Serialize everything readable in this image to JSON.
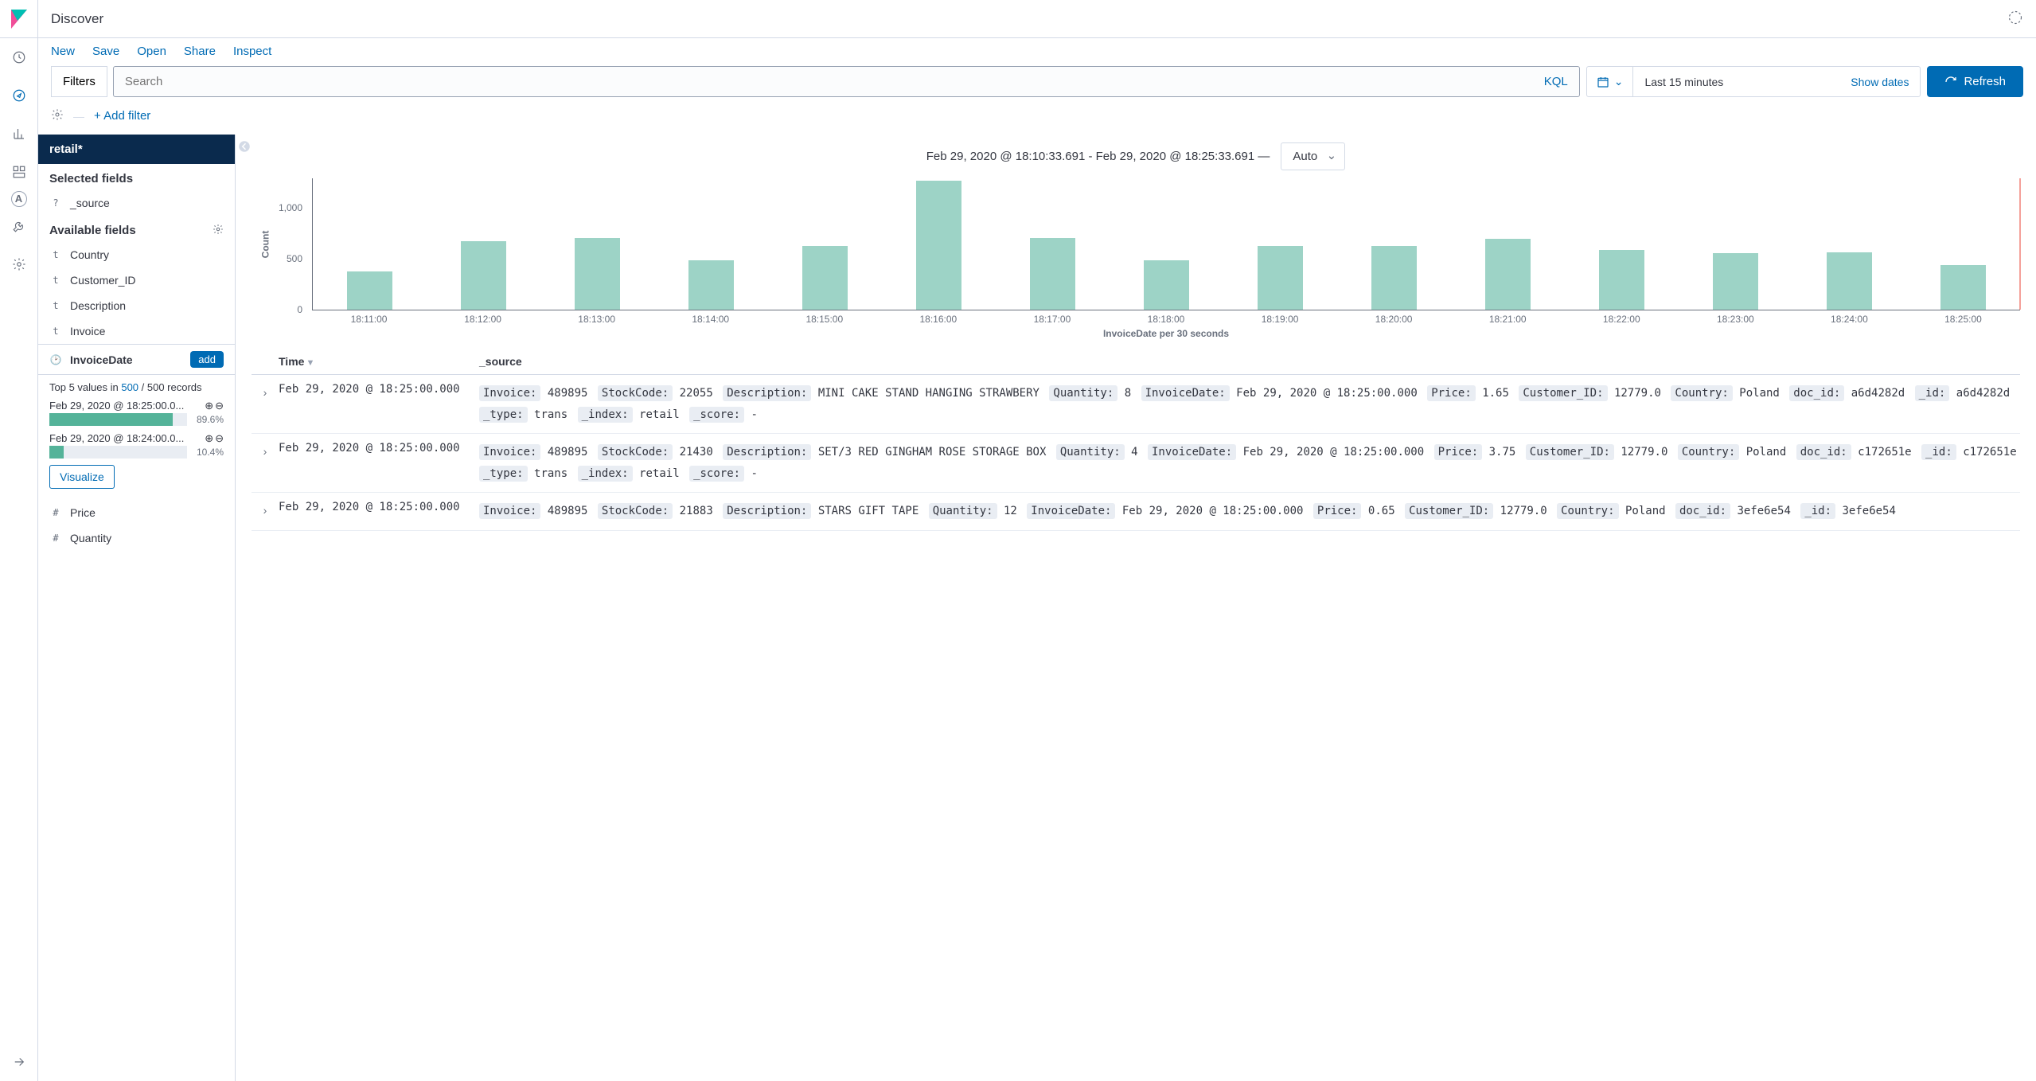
{
  "app": {
    "title": "Discover"
  },
  "subnav": {
    "new": "New",
    "save": "Save",
    "open": "Open",
    "share": "Share",
    "inspect": "Inspect"
  },
  "search": {
    "filters_btn": "Filters",
    "placeholder": "Search",
    "kql": "KQL"
  },
  "datepicker": {
    "range": "Last 15 minutes",
    "show_dates": "Show dates"
  },
  "refresh": {
    "label": "Refresh"
  },
  "filterbar": {
    "add_filter": "+ Add filter"
  },
  "sidebar": {
    "index_pattern": "retail*",
    "selected_title": "Selected fields",
    "selected": [
      {
        "icon": "?",
        "name": "_source"
      }
    ],
    "available_title": "Available fields",
    "available": [
      {
        "icon": "t",
        "name": "Country"
      },
      {
        "icon": "t",
        "name": "Customer_ID"
      },
      {
        "icon": "t",
        "name": "Description"
      },
      {
        "icon": "t",
        "name": "Invoice"
      }
    ],
    "selected_field": {
      "icon": "🕑",
      "name": "InvoiceDate",
      "add": "add"
    },
    "field_details": {
      "prefix": "Top 5 values in ",
      "link": "500",
      "suffix": " / 500 records",
      "rows": [
        {
          "label": "Feb 29, 2020 @ 18:25:00.0...",
          "pct": "89.6%",
          "width": 89.6
        },
        {
          "label": "Feb 29, 2020 @ 18:24:00.0...",
          "pct": "10.4%",
          "width": 10.4
        }
      ],
      "visualize": "Visualize"
    },
    "after": [
      {
        "icon": "#",
        "name": "Price"
      },
      {
        "icon": "#",
        "name": "Quantity"
      }
    ]
  },
  "histogram": {
    "range_text": "Feb 29, 2020 @ 18:10:33.691 - Feb 29, 2020 @ 18:25:33.691 —",
    "interval": "Auto"
  },
  "chart_data": {
    "type": "bar",
    "xlabel": "InvoiceDate per 30 seconds",
    "ylabel": "Count",
    "yticks": [
      0,
      500,
      1000
    ],
    "ylim": [
      0,
      1300
    ],
    "xticks": [
      "18:11:00",
      "18:12:00",
      "18:13:00",
      "18:14:00",
      "18:15:00",
      "18:16:00",
      "18:17:00",
      "18:18:00",
      "18:19:00",
      "18:20:00",
      "18:21:00",
      "18:22:00",
      "18:23:00",
      "18:24:00",
      "18:25:00"
    ],
    "values": [
      380,
      680,
      710,
      490,
      630,
      1280,
      710,
      490,
      630,
      630,
      700,
      590,
      560,
      570,
      440
    ]
  },
  "table": {
    "headers": {
      "time": "Time",
      "source": "_source"
    },
    "rows": [
      {
        "time": "Feb 29, 2020 @ 18:25:00.000",
        "fields": [
          {
            "k": "Invoice:",
            "v": "489895"
          },
          {
            "k": "StockCode:",
            "v": "22055"
          },
          {
            "k": "Description:",
            "v": "MINI CAKE STAND HANGING STRAWBERY"
          },
          {
            "k": "Quantity:",
            "v": "8"
          },
          {
            "k": "InvoiceDate:",
            "v": "Feb 29, 2020 @ 18:25:00.000"
          },
          {
            "k": "Price:",
            "v": "1.65"
          },
          {
            "k": "Customer_ID:",
            "v": "12779.0"
          },
          {
            "k": "Country:",
            "v": "Poland"
          },
          {
            "k": "doc_id:",
            "v": "a6d4282d"
          },
          {
            "k": "_id:",
            "v": "a6d4282d"
          },
          {
            "k": "_type:",
            "v": "trans"
          },
          {
            "k": "_index:",
            "v": "retail"
          },
          {
            "k": "_score:",
            "v": " - "
          }
        ]
      },
      {
        "time": "Feb 29, 2020 @ 18:25:00.000",
        "fields": [
          {
            "k": "Invoice:",
            "v": "489895"
          },
          {
            "k": "StockCode:",
            "v": "21430"
          },
          {
            "k": "Description:",
            "v": "SET/3 RED GINGHAM ROSE STORAGE BOX"
          },
          {
            "k": "Quantity:",
            "v": "4"
          },
          {
            "k": "InvoiceDate:",
            "v": "Feb 29, 2020 @ 18:25:00.000"
          },
          {
            "k": "Price:",
            "v": "3.75"
          },
          {
            "k": "Customer_ID:",
            "v": "12779.0"
          },
          {
            "k": "Country:",
            "v": "Poland"
          },
          {
            "k": "doc_id:",
            "v": "c172651e"
          },
          {
            "k": "_id:",
            "v": "c172651e"
          },
          {
            "k": "_type:",
            "v": "trans"
          },
          {
            "k": "_index:",
            "v": "retail"
          },
          {
            "k": "_score:",
            "v": " - "
          }
        ]
      },
      {
        "time": "Feb 29, 2020 @ 18:25:00.000",
        "fields": [
          {
            "k": "Invoice:",
            "v": "489895"
          },
          {
            "k": "StockCode:",
            "v": "21883"
          },
          {
            "k": "Description:",
            "v": "STARS GIFT TAPE"
          },
          {
            "k": "Quantity:",
            "v": "12"
          },
          {
            "k": "InvoiceDate:",
            "v": "Feb 29, 2020 @ 18:25:00.000"
          },
          {
            "k": "Price:",
            "v": "0.65"
          },
          {
            "k": "Customer_ID:",
            "v": "12779.0"
          },
          {
            "k": "Country:",
            "v": "Poland"
          },
          {
            "k": "doc_id:",
            "v": "3efe6e54"
          },
          {
            "k": "_id:",
            "v": "3efe6e54"
          }
        ]
      }
    ]
  }
}
